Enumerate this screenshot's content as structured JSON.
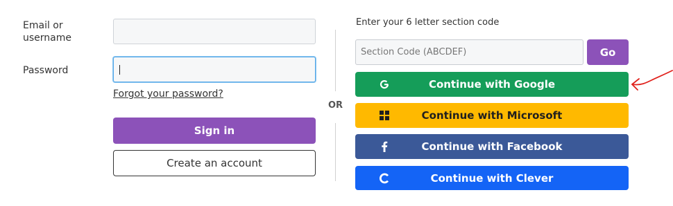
{
  "login": {
    "email_label": "Email or username",
    "password_label": "Password",
    "forgot_password": "Forgot your password?",
    "sign_in": "Sign in",
    "create_account": "Create an account"
  },
  "divider": {
    "or": "OR"
  },
  "section_code": {
    "prompt": "Enter your 6 letter section code",
    "placeholder": "Section Code (ABCDEF)",
    "go": "Go"
  },
  "sso": [
    {
      "label": "Continue with Google",
      "icon": "google-icon",
      "color": "#159d59"
    },
    {
      "label": "Continue with Microsoft",
      "icon": "microsoft-icon",
      "color": "#ffb900"
    },
    {
      "label": "Continue with Facebook",
      "icon": "facebook-icon",
      "color": "#3b5998"
    },
    {
      "label": "Continue with Clever",
      "icon": "clever-icon",
      "color": "#1464f6"
    }
  ],
  "colors": {
    "primary_purple": "#8c52b9",
    "annotation_red": "#e0211c"
  }
}
